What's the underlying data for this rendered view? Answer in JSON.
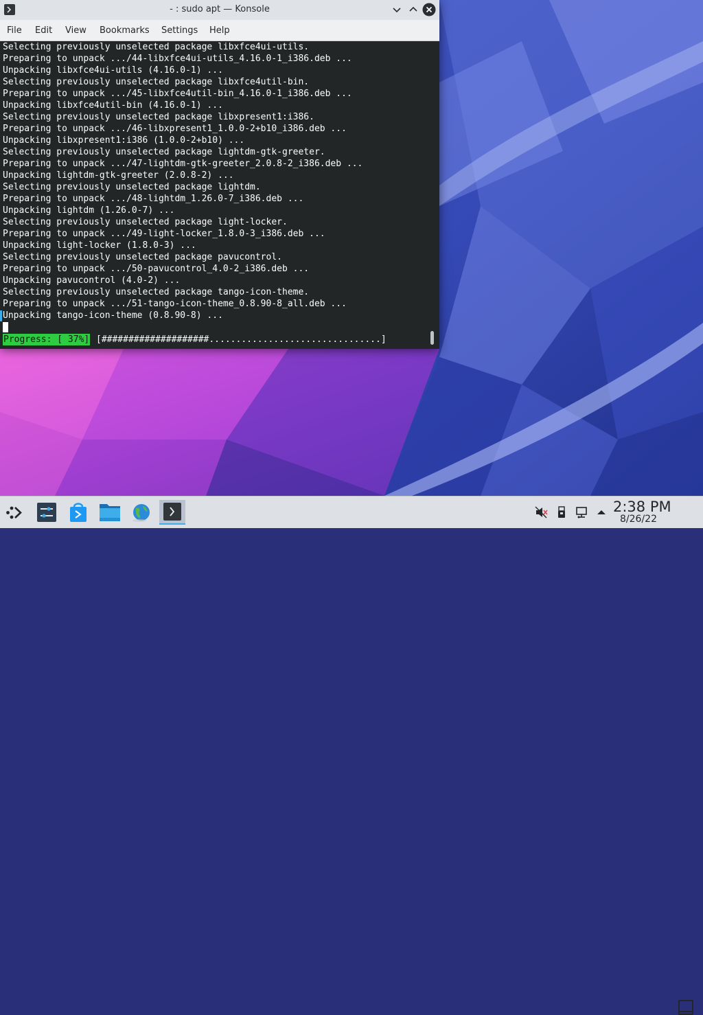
{
  "window": {
    "title": "- : sudo apt — Konsole",
    "icons": {
      "app": "terminal-icon",
      "minimize": "chevron-down-icon",
      "maximize": "chevron-up-icon",
      "close": "close-icon"
    }
  },
  "menubar": {
    "items": [
      "File",
      "Edit",
      "View",
      "Bookmarks",
      "Settings",
      "Help"
    ]
  },
  "terminal": {
    "lines": [
      "Selecting previously unselected package libxfce4ui-utils.",
      "Preparing to unpack .../44-libxfce4ui-utils_4.16.0-1_i386.deb ...",
      "Unpacking libxfce4ui-utils (4.16.0-1) ...",
      "Selecting previously unselected package libxfce4util-bin.",
      "Preparing to unpack .../45-libxfce4util-bin_4.16.0-1_i386.deb ...",
      "Unpacking libxfce4util-bin (4.16.0-1) ...",
      "Selecting previously unselected package libxpresent1:i386.",
      "Preparing to unpack .../46-libxpresent1_1.0.0-2+b10_i386.deb ...",
      "Unpacking libxpresent1:i386 (1.0.0-2+b10) ...",
      "Selecting previously unselected package lightdm-gtk-greeter.",
      "Preparing to unpack .../47-lightdm-gtk-greeter_2.0.8-2_i386.deb ...",
      "Unpacking lightdm-gtk-greeter (2.0.8-2) ...",
      "Selecting previously unselected package lightdm.",
      "Preparing to unpack .../48-lightdm_1.26.0-7_i386.deb ...",
      "Unpacking lightdm (1.26.0-7) ...",
      "Selecting previously unselected package light-locker.",
      "Preparing to unpack .../49-light-locker_1.8.0-3_i386.deb ...",
      "Unpacking light-locker (1.8.0-3) ...",
      "Selecting previously unselected package pavucontrol.",
      "Preparing to unpack .../50-pavucontrol_4.0-2_i386.deb ...",
      "Unpacking pavucontrol (4.0-2) ...",
      "Selecting previously unselected package tango-icon-theme.",
      "Preparing to unpack .../51-tango-icon-theme_0.8.90-8_all.deb ...",
      "Unpacking tango-icon-theme (0.8.90-8) ..."
    ],
    "progress_label": "Progress: [ 37%]",
    "progress_bar": "[####################................................]",
    "progress_percent": 37,
    "colors": {
      "background": "#232627",
      "foreground": "#fcfcfc",
      "progress_highlight": "#2ecc40"
    }
  },
  "taskbar": {
    "launcher": "application-launcher-icon",
    "tasks": [
      {
        "name": "system-settings-icon",
        "active": false
      },
      {
        "name": "discover-store-icon",
        "active": false
      },
      {
        "name": "file-manager-icon",
        "active": false
      },
      {
        "name": "web-browser-icon",
        "active": false
      },
      {
        "name": "konsole-terminal-icon",
        "active": true
      }
    ],
    "tray": [
      "volume-muted-icon",
      "removable-device-icon",
      "network-wired-icon",
      "expand-tray-arrow-icon"
    ],
    "clock": {
      "time": "2:38 PM",
      "date": "8/26/22"
    },
    "show_desktop": "show-desktop-icon"
  }
}
